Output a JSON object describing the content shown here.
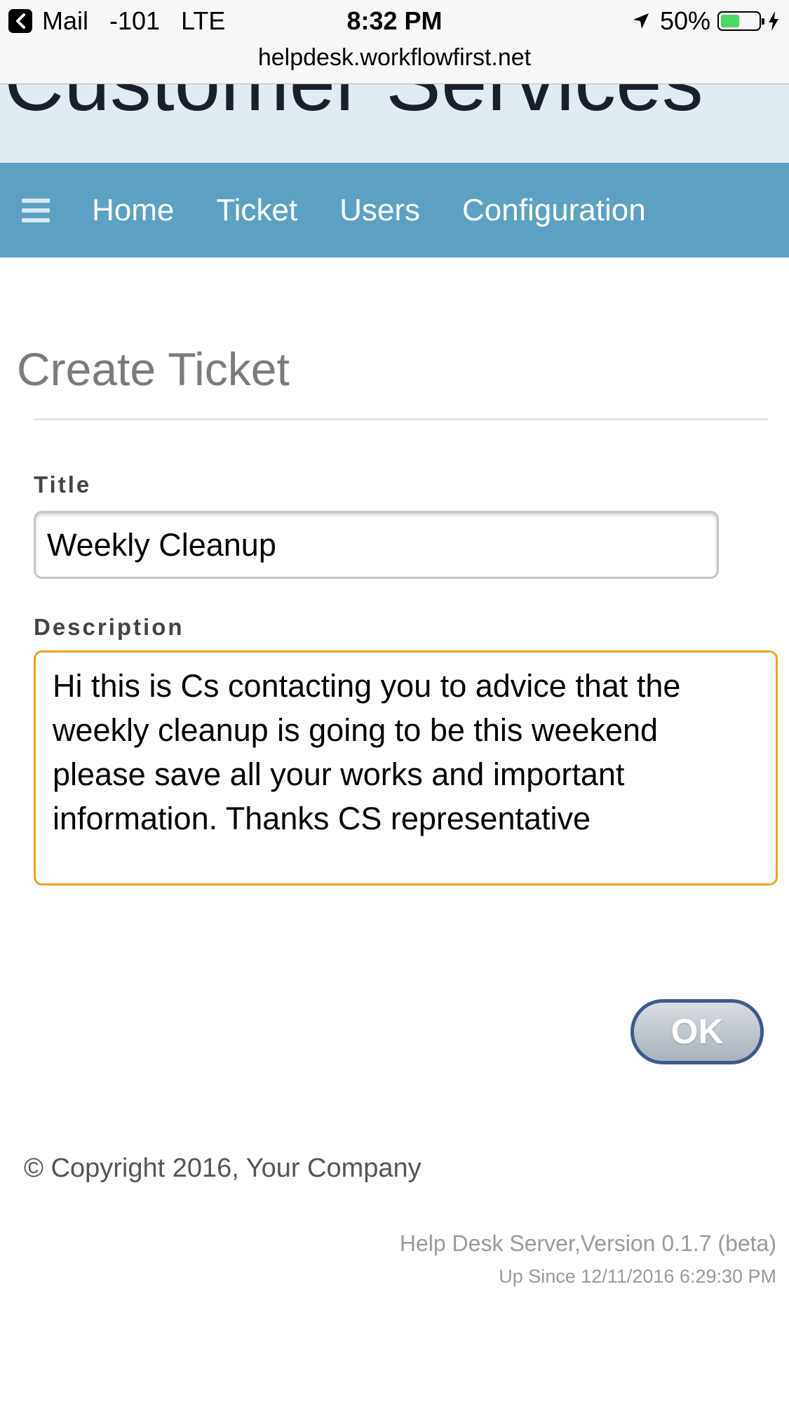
{
  "status_bar": {
    "back_app": "Mail",
    "signal": "-101",
    "network": "LTE",
    "time": "8:32 PM",
    "battery_percent": "50%",
    "battery_level": 0.5,
    "url": "helpdesk.workflowfirst.net"
  },
  "banner": {
    "title": "Customer Services"
  },
  "nav": {
    "items": [
      "Home",
      "Ticket",
      "Users",
      "Configuration"
    ]
  },
  "form": {
    "heading": "Create Ticket",
    "title_label": "Title",
    "title_value": "Weekly Cleanup",
    "description_label": "Description",
    "description_value": "Hi this is Cs contacting you to advice that the weekly cleanup is going to be this weekend please save all your works and important information. Thanks CS representative",
    "ok_label": "OK"
  },
  "footer": {
    "copyright": "© Copyright 2016, Your Company",
    "version": "Help Desk Server,Version 0.1.7 (beta)",
    "up_since": "Up Since 12/11/2016 6:29:30 PM"
  },
  "colors": {
    "nav_bg": "#5ca1c3",
    "banner_bg": "#e0ecf2",
    "focus_border": "#f3a21c",
    "ok_border": "#3b5a8e"
  }
}
